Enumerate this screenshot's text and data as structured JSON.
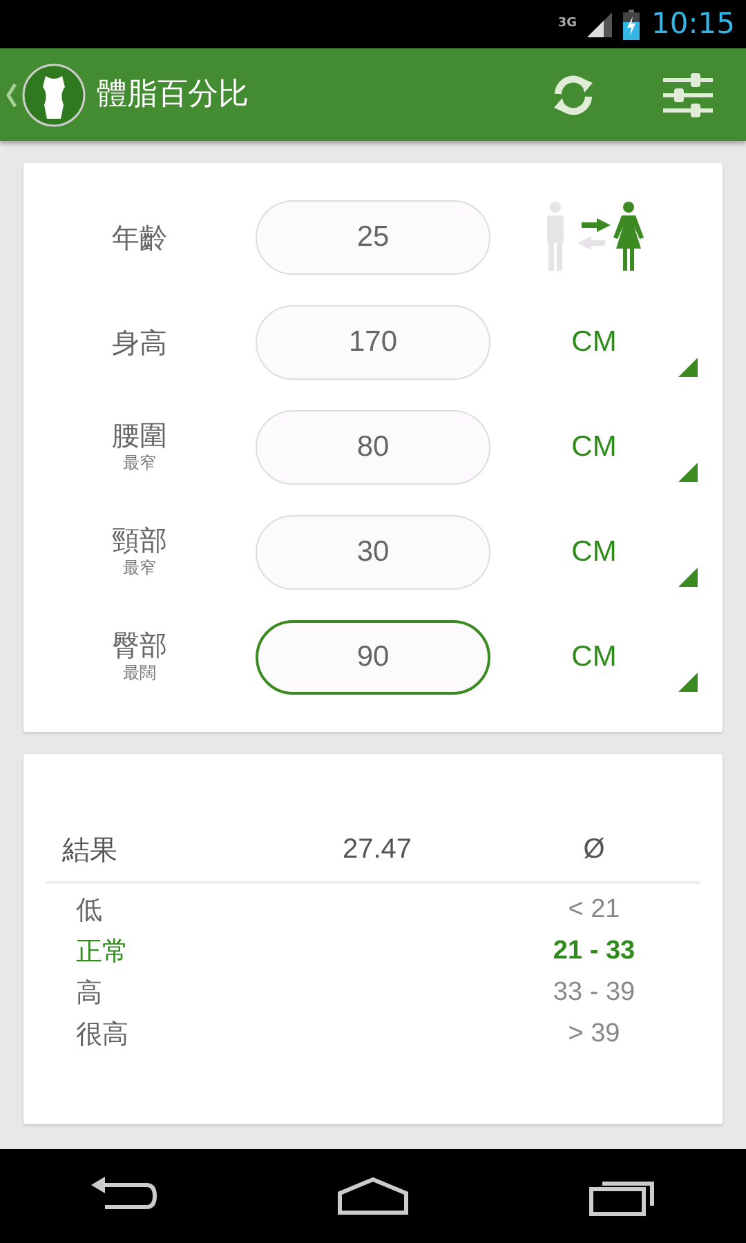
{
  "status_bar": {
    "network": "3G",
    "time": "10:15"
  },
  "app_bar": {
    "title": "體脂百分比"
  },
  "inputs": [
    {
      "kind": "age",
      "label": "年齡",
      "value": "25",
      "focused": false
    },
    {
      "kind": "measure",
      "label": "身高",
      "value": "170",
      "unit": "CM",
      "focused": false
    },
    {
      "kind": "measure",
      "label": "腰圍",
      "sublabel": "最窄",
      "value": "80",
      "unit": "CM",
      "focused": false
    },
    {
      "kind": "measure",
      "label": "頸部",
      "sublabel": "最窄",
      "value": "30",
      "unit": "CM",
      "focused": false
    },
    {
      "kind": "measure",
      "label": "臀部",
      "sublabel": "最闊",
      "value": "90",
      "unit": "CM",
      "focused": true
    }
  ],
  "result": {
    "label": "結果",
    "value": "27.47",
    "symbol": "Ø",
    "ranges": [
      {
        "label": "低",
        "range": "< 21",
        "selected": false
      },
      {
        "label": "正常",
        "range": "21 - 33",
        "selected": true
      },
      {
        "label": "高",
        "range": "33 - 39",
        "selected": false
      },
      {
        "label": "很高",
        "range": "> 39",
        "selected": false
      }
    ]
  }
}
